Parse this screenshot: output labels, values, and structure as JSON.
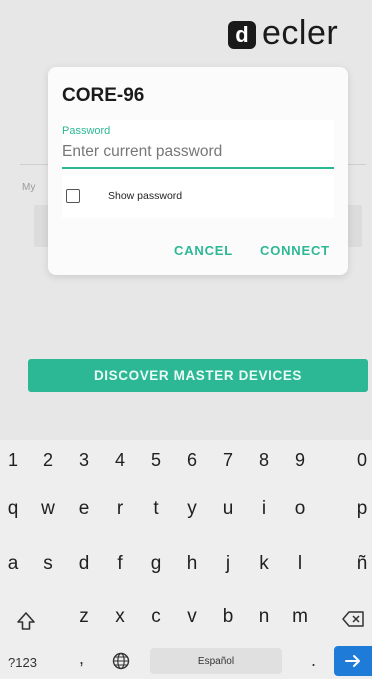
{
  "brand": {
    "mark": "d",
    "name": "ecler"
  },
  "background": {
    "field_label": "My",
    "discover_button": "DISCOVER MASTER DEVICES"
  },
  "dialog": {
    "title": "CORE-96",
    "password_label": "Password",
    "password_placeholder": "Enter current password",
    "password_value": "",
    "show_password_label": "Show password",
    "show_password_checked": false,
    "cancel_label": "CANCEL",
    "connect_label": "CONNECT"
  },
  "keyboard": {
    "numbers": [
      "1",
      "2",
      "3",
      "4",
      "5",
      "6",
      "7",
      "8",
      "9",
      "0"
    ],
    "row1": [
      "q",
      "w",
      "e",
      "r",
      "t",
      "y",
      "u",
      "i",
      "o",
      "p"
    ],
    "row2": [
      "a",
      "s",
      "d",
      "f",
      "g",
      "h",
      "j",
      "k",
      "l",
      "ñ"
    ],
    "row3": [
      "z",
      "x",
      "c",
      "v",
      "b",
      "n",
      "m"
    ],
    "symbols_label": "?123",
    "comma": ",",
    "period": ".",
    "space_label": "Español",
    "icons": {
      "shift": "shift-icon",
      "backspace": "backspace-icon",
      "globe": "globe-icon",
      "enter": "enter-arrow-icon"
    }
  },
  "colors": {
    "accent": "#2db895",
    "enter_key": "#1e7bd8"
  }
}
